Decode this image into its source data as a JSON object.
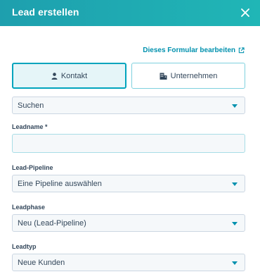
{
  "header": {
    "title": "Lead erstellen"
  },
  "edit_form_link": "Dieses Formular bearbeiten",
  "tabs": [
    {
      "label": "Kontakt",
      "icon": "person-icon",
      "active": true
    },
    {
      "label": "Unternehmen",
      "icon": "building-icon",
      "active": false
    }
  ],
  "search_select": {
    "value": "Suchen"
  },
  "lead_name": {
    "label": "Leadname *",
    "value": ""
  },
  "lead_pipeline": {
    "label": "Lead-Pipeline",
    "value": "Eine Pipeline auswählen"
  },
  "lead_phase": {
    "label": "Leadphase",
    "value": "Neu (Lead-Pipeline)"
  },
  "lead_type": {
    "label": "Leadtyp",
    "value": "Neue Kunden"
  },
  "colors": {
    "header": "#1fa9b2",
    "accent": "#00a4bd",
    "link": "#0091ae",
    "input_bg": "#f5f8fa"
  }
}
